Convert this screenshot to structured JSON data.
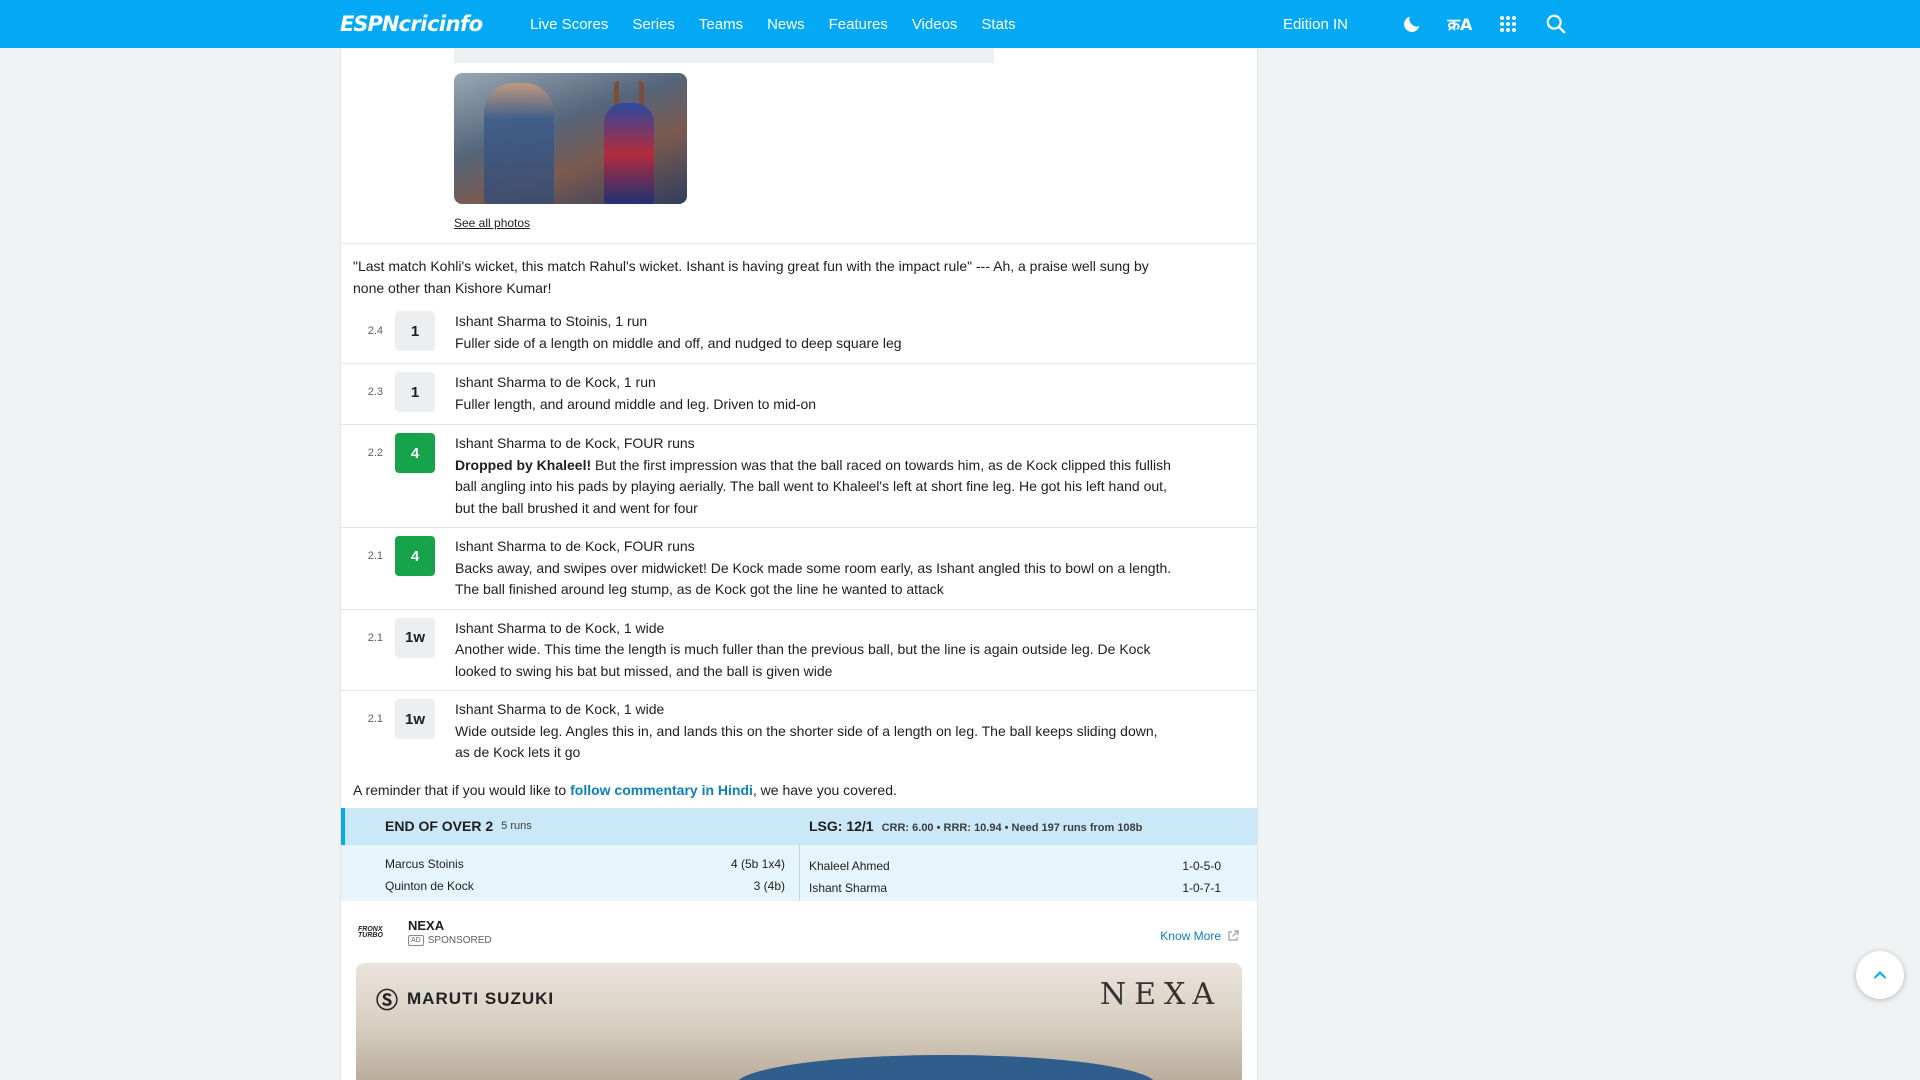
{
  "nav": {
    "logo_espn": "ESPN",
    "logo_cricinfo": "cricinfo",
    "links": [
      "Live Scores",
      "Series",
      "Teams",
      "News",
      "Features",
      "Videos",
      "Stats"
    ],
    "edition": "Edition IN",
    "icons": [
      "moon-icon",
      "hindi-icon",
      "apps-grid-icon",
      "search-icon"
    ],
    "hindi_glyph": "क्रA"
  },
  "photos": {
    "see_all": "See all photos"
  },
  "commentary": {
    "note": "\"Last match Kohli's wicket, this match Rahul's wicket. Ishant is having great fun with the impact rule\" --- Ah, a praise well sung by none other than Kishore Kumar!",
    "balls": [
      {
        "over": "2.4",
        "result": "1",
        "type": "run",
        "title": "Ishant Sharma to Stoinis, 1 run",
        "bold": "",
        "text": "Fuller side of a length on middle and off, and nudged to deep square leg"
      },
      {
        "over": "2.3",
        "result": "1",
        "type": "run",
        "title": "Ishant Sharma to de Kock, 1 run",
        "bold": "",
        "text": "Fuller length, and around middle and leg. Driven to mid-on"
      },
      {
        "over": "2.2",
        "result": "4",
        "type": "four",
        "title": "Ishant Sharma to de Kock, FOUR runs",
        "bold": "Dropped by Khaleel!",
        "text": " But the first impression was that the ball raced on towards him, as de Kock clipped this fullish ball angling into his pads by playing aerially. The ball went to Khaleel's left at short fine leg. He got his left hand out, but the ball brushed it and went for four"
      },
      {
        "over": "2.1",
        "result": "4",
        "type": "four",
        "title": "Ishant Sharma to de Kock, FOUR runs",
        "bold": "",
        "text": "Backs away, and swipes over midwicket! De Kock made some room early, as Ishant angled this to bowl on a length. The ball finished around leg stump, as de Kock got the line he wanted to attack"
      },
      {
        "over": "2.1",
        "result": "1w",
        "type": "wide",
        "title": "Ishant Sharma to de Kock, 1 wide",
        "bold": "",
        "text": "Another wide. This time the length is much fuller than the previous ball, but the line is again outside leg. De Kock looked to swing his bat but missed, and the ball is given wide"
      },
      {
        "over": "2.1",
        "result": "1w",
        "type": "wide",
        "title": "Ishant Sharma to de Kock, 1 wide",
        "bold": "",
        "text": "Wide outside leg. Angles this in, and lands this on the shorter side of a length on leg. The ball keeps sliding down, as de Kock lets it go"
      }
    ],
    "reminder_pre": "A reminder that if you would like to ",
    "reminder_link": "follow commentary in Hindi",
    "reminder_post": ", we have you covered."
  },
  "end_of_over": {
    "label": "END OF OVER 2",
    "runs": "5 runs",
    "team_score": "LSG: 12/1",
    "rates": "CRR: 6.00 • RRR: 10.94 • Need 197 runs from 108b",
    "batters": [
      {
        "name": "Marcus Stoinis",
        "score": "4 (5b 1x4)"
      },
      {
        "name": "Quinton de Kock",
        "score": "3 (4b)"
      }
    ],
    "bowlers": [
      {
        "name": "Khaleel Ahmed",
        "figures": "1-0-5-0"
      },
      {
        "name": "Ishant Sharma",
        "figures": "1-0-7-1"
      }
    ]
  },
  "sponsored": {
    "logo_text": "FRONX TURBO",
    "name": "NEXA",
    "ad_badge": "AD",
    "tag": "SPONSORED",
    "cta": "Know More",
    "banner_brand": "MARUTI SUZUKI",
    "banner_title": "NEXA"
  },
  "colors": {
    "nav_bg": "#03a9f4",
    "four_badge": "#16a34a",
    "link": "#0c7fbf",
    "eoo_header": "#cbe8f8"
  }
}
